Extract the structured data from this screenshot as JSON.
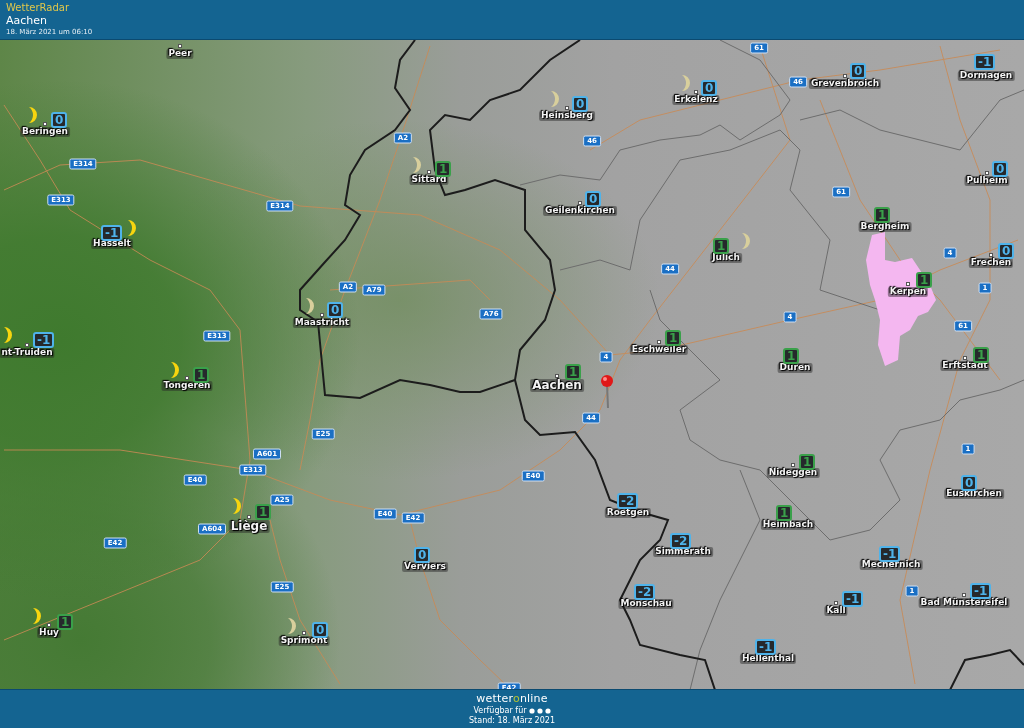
{
  "header": {
    "app_name": "WetterRadar",
    "location": "Aachen",
    "timestamp": "18. März 2021 um 06:10"
  },
  "map": {
    "cities": [
      {
        "name": "Peer",
        "kind": "small"
      },
      {
        "name": "Beringen",
        "kind": "small",
        "temp": "0",
        "color": "#4fb3ea",
        "moon": true,
        "moon_faded": false
      },
      {
        "name": "Hasselt",
        "kind": "small",
        "temp": "-1",
        "color": "#4fb3ea",
        "moon": true,
        "moon_faded": false
      },
      {
        "name": "nt-Truiden",
        "kind": "small",
        "temp": "-1",
        "color": "#4fb3ea",
        "moon": true,
        "moon_faded": false
      },
      {
        "name": "Tongeren",
        "kind": "small",
        "temp": "1",
        "color": "#3aa04a",
        "moon": true,
        "moon_faded": false
      },
      {
        "name": "Maastricht",
        "kind": "small",
        "temp": "0",
        "color": "#4fb3ea",
        "moon": true,
        "moon_faded": true
      },
      {
        "name": "Sittard",
        "kind": "small",
        "temp": "1",
        "color": "#3aa04a",
        "moon": true,
        "moon_faded": true
      },
      {
        "name": "Liège",
        "kind": "large",
        "temp": "1",
        "color": "#3aa04a",
        "moon": true,
        "moon_faded": false
      },
      {
        "name": "Huy",
        "kind": "small",
        "temp": "1",
        "color": "#3aa04a",
        "moon": true,
        "moon_faded": false
      },
      {
        "name": "Sprimont",
        "kind": "small",
        "temp": "0",
        "color": "#4fb3ea",
        "moon": true,
        "moon_faded": true
      },
      {
        "name": "Verviers",
        "kind": "small",
        "temp": "0",
        "color": "#4fb3ea"
      },
      {
        "name": "Heinsberg",
        "kind": "small",
        "temp": "0",
        "color": "#4fb3ea",
        "moon": true,
        "moon_faded": true
      },
      {
        "name": "Erkelenz",
        "kind": "small",
        "temp": "0",
        "color": "#4fb3ea",
        "moon": true,
        "moon_faded": true
      },
      {
        "name": "Grevenbroich",
        "kind": "small",
        "temp": "0",
        "color": "#4fb3ea"
      },
      {
        "name": "Dormagen",
        "kind": "small",
        "temp": "-1",
        "color": "#4fb3ea"
      },
      {
        "name": "Geilenkirchen",
        "kind": "small",
        "temp": "0",
        "color": "#4fb3ea"
      },
      {
        "name": "Jülich",
        "kind": "small",
        "temp": "1",
        "color": "#3aa04a",
        "moon": true,
        "moon_faded": true
      },
      {
        "name": "Pulheim",
        "kind": "small",
        "temp": "0",
        "color": "#4fb3ea"
      },
      {
        "name": "Bergheim",
        "kind": "small",
        "temp": "1",
        "color": "#3aa04a"
      },
      {
        "name": "Kerpen",
        "kind": "small",
        "temp": "1",
        "color": "#3aa04a"
      },
      {
        "name": "Frechen",
        "kind": "small",
        "temp": "0",
        "color": "#4fb3ea"
      },
      {
        "name": "Eschweiler",
        "kind": "small",
        "temp": "1",
        "color": "#3aa04a"
      },
      {
        "name": "Düren",
        "kind": "small",
        "temp": "1",
        "color": "#3aa04a"
      },
      {
        "name": "Erftstadt",
        "kind": "small",
        "temp": "1",
        "color": "#3aa04a"
      },
      {
        "name": "Aachen",
        "kind": "large",
        "temp": "1",
        "color": "#3aa04a"
      },
      {
        "name": "Roetgen",
        "kind": "small",
        "temp": "-2",
        "color": "#4fb3ea"
      },
      {
        "name": "Simmerath",
        "kind": "small",
        "temp": "-2",
        "color": "#4fb3ea"
      },
      {
        "name": "Monschau",
        "kind": "small",
        "temp": "-2",
        "color": "#4fb3ea"
      },
      {
        "name": "Nideggen",
        "kind": "small",
        "temp": "1",
        "color": "#3aa04a"
      },
      {
        "name": "Heimbach",
        "kind": "small",
        "temp": "1",
        "color": "#3aa04a"
      },
      {
        "name": "Euskirchen",
        "kind": "small",
        "temp": "0",
        "color": "#4fb3ea"
      },
      {
        "name": "Mechernich",
        "kind": "small",
        "temp": "-1",
        "color": "#4fb3ea"
      },
      {
        "name": "Kall",
        "kind": "small",
        "temp": "-1",
        "color": "#4fb3ea"
      },
      {
        "name": "Bad Münstereifel",
        "kind": "small",
        "temp": "-1",
        "color": "#4fb3ea"
      },
      {
        "name": "Hellenthal",
        "kind": "small",
        "temp": "-1",
        "color": "#4fb3ea"
      }
    ],
    "roads": [
      "E314",
      "E313",
      "E314",
      "A2",
      "A2",
      "A79",
      "A76",
      "E313",
      "E25",
      "A601",
      "E313",
      "E40",
      "A25",
      "A604",
      "E42",
      "E25",
      "E40",
      "E42",
      "E40",
      "44",
      "4",
      "E42",
      "61",
      "46",
      "46",
      "61",
      "44",
      "4",
      "1",
      "4",
      "61",
      "1",
      "1"
    ]
  },
  "footer": {
    "logo_parts": [
      "wetter",
      "o",
      "nline"
    ],
    "availability": "Verfügbar für",
    "updated": "Stand: 18. März 2021"
  }
}
